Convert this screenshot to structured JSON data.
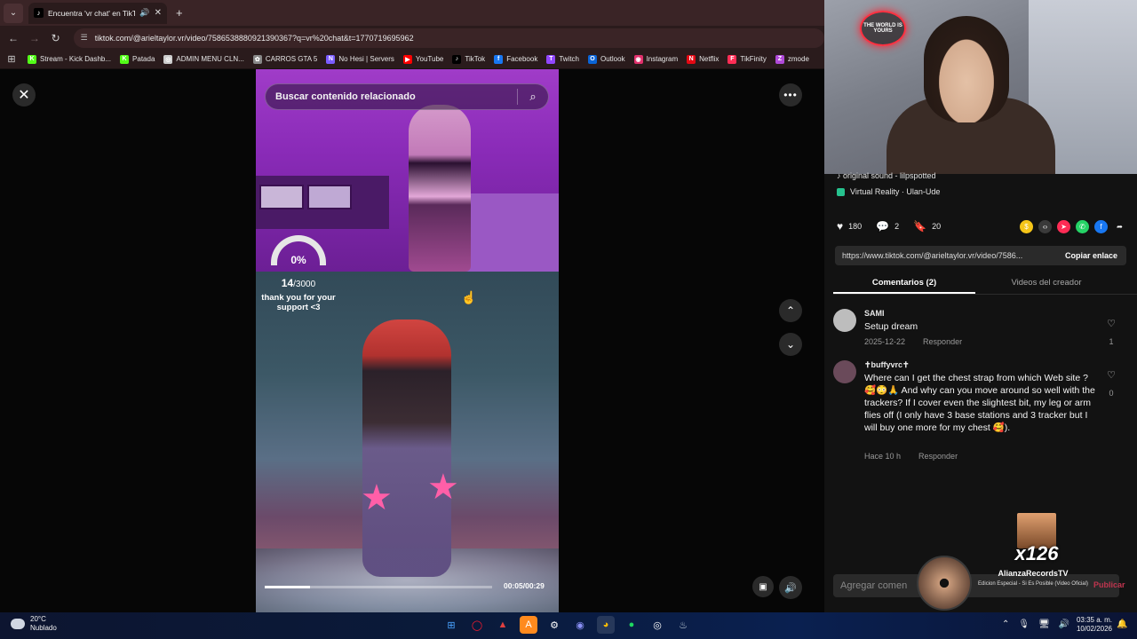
{
  "browser": {
    "tab_title": "Encuentra 'vr chat' en TikTok",
    "url": "tiktok.com/@arieltaylor.vr/video/7586538880921390367?q=vr%20chat&t=1770719695962",
    "bookmarks": [
      {
        "label": "Stream - Kick Dashb...",
        "color": "#53fc18",
        "icon": "K"
      },
      {
        "label": "Patada",
        "color": "#53fc18",
        "icon": "K"
      },
      {
        "label": "ADMIN MENU CLN...",
        "color": "#cccccc",
        "icon": "◎"
      },
      {
        "label": "CARROS GTA 5",
        "color": "#888888",
        "icon": "✿"
      },
      {
        "label": "No Hesi | Servers",
        "color": "#7b5cff",
        "icon": "N"
      },
      {
        "label": "YouTube",
        "color": "#ff0000",
        "icon": "▶"
      },
      {
        "label": "TikTok",
        "color": "#000000",
        "icon": "♪"
      },
      {
        "label": "Facebook",
        "color": "#1877f2",
        "icon": "f"
      },
      {
        "label": "Twitch",
        "color": "#9146ff",
        "icon": "T"
      },
      {
        "label": "Outlook",
        "color": "#0a64d6",
        "icon": "O"
      },
      {
        "label": "Instagram",
        "color": "#e1306c",
        "icon": "◉"
      },
      {
        "label": "Netflix",
        "color": "#e50914",
        "icon": "N"
      },
      {
        "label": "TikFinity",
        "color": "#ff2d55",
        "icon": "F"
      },
      {
        "label": "zmode",
        "color": "#b04ad8",
        "icon": "Z"
      }
    ]
  },
  "video": {
    "search_placeholder": "Buscar contenido relacionado",
    "gauge_percent": "0%",
    "goal_current": "14",
    "goal_total": "/3000",
    "goal_message": "thank you for your support <3",
    "time": "00:05/00:29",
    "progress": 0.2
  },
  "panel": {
    "sound": "♪ original sound - lilpspotted",
    "location": "Virtual Reality · Ulan-Ude",
    "likes": "180",
    "comments": "2",
    "saves": "20",
    "share_url": "https://www.tiktok.com/@arieltaylor.vr/video/7586...",
    "copy_label": "Copiar enlace",
    "tab_comments": "Comentarios (2)",
    "tab_creator": "Videos del creador",
    "comment_list": [
      {
        "name": "SAMI",
        "text": "Setup dream",
        "date": "2025-12-22",
        "reply": "Responder",
        "likes": "1"
      },
      {
        "name": "✝buffyvrc✝",
        "text": "Where can I get the chest strap from which Web site ? 🥰😳🙏 And why can you move around so well with the trackers? If I cover even the slightest bit, my leg or arm flies off (I only have 3 base stations and 3 tracker but I will buy one more for my chest 🥰).",
        "date": "Hace 10 h",
        "reply": "Responder",
        "likes": "0"
      }
    ],
    "comment_placeholder": "Agregar comen",
    "post_label": "Publicar",
    "overlay_count": "x126",
    "now_playing_artist": "AlianzaRecordsTV",
    "now_playing_song": "Edicion Especial - Si Es Posible (Video Oficial)",
    "webcam_sign": "THE WORLD IS YOURS"
  },
  "taskbar": {
    "temp": "20°C",
    "weather": "Nublado",
    "time": "03:35 a. m.",
    "date": "10/02/2026"
  }
}
